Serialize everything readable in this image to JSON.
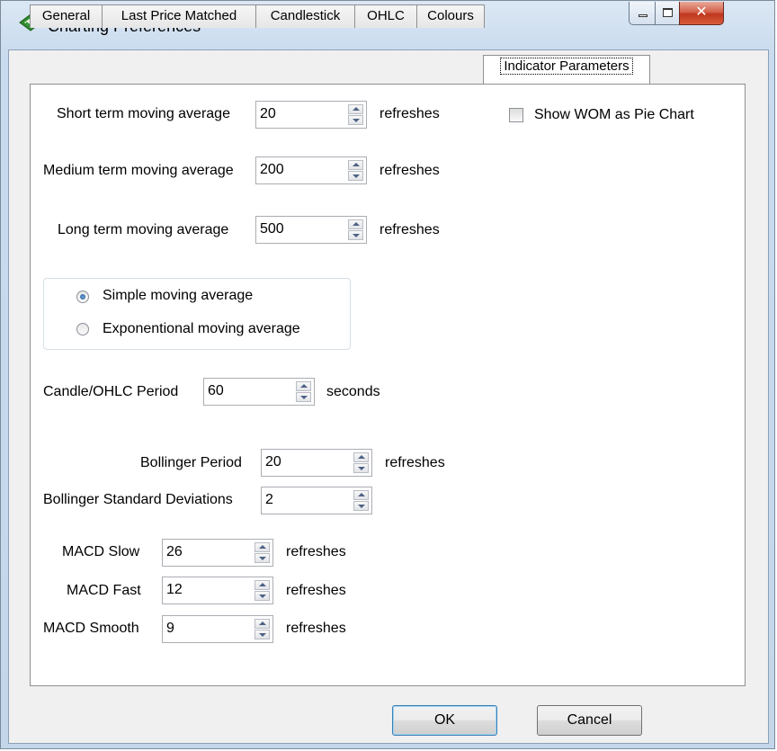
{
  "window": {
    "title": "Charting Preferences"
  },
  "tabs": [
    {
      "label": "General"
    },
    {
      "label": "Last Price Matched"
    },
    {
      "label": "Candlestick"
    },
    {
      "label": "OHLC"
    },
    {
      "label": "Colours"
    },
    {
      "label": "Indicator Parameters",
      "active": true
    }
  ],
  "moving_averages": {
    "short": {
      "label": "Short term moving average",
      "value": "20",
      "unit": "refreshes"
    },
    "medium": {
      "label": "Medium term moving average",
      "value": "200",
      "unit": "refreshes"
    },
    "long": {
      "label": "Long term moving average",
      "value": "500",
      "unit": "refreshes"
    }
  },
  "show_wom": {
    "label": "Show WOM as Pie Chart",
    "checked": false
  },
  "ma_type": {
    "options": [
      "Simple moving average",
      "Exponentional moving average"
    ],
    "selected": "Simple moving average"
  },
  "candle_period": {
    "label": "Candle/OHLC Period",
    "value": "60",
    "unit": "seconds"
  },
  "bollinger": {
    "period": {
      "label": "Bollinger Period",
      "value": "20",
      "unit": "refreshes"
    },
    "std_dev": {
      "label": "Bollinger Standard Deviations",
      "value": "2"
    }
  },
  "macd": {
    "slow": {
      "label": "MACD Slow",
      "value": "26",
      "unit": "refreshes"
    },
    "fast": {
      "label": "MACD Fast",
      "value": "12",
      "unit": "refreshes"
    },
    "smooth": {
      "label": "MACD Smooth",
      "value": "9",
      "unit": "refreshes"
    }
  },
  "buttons": {
    "ok": "OK",
    "cancel": "Cancel"
  }
}
